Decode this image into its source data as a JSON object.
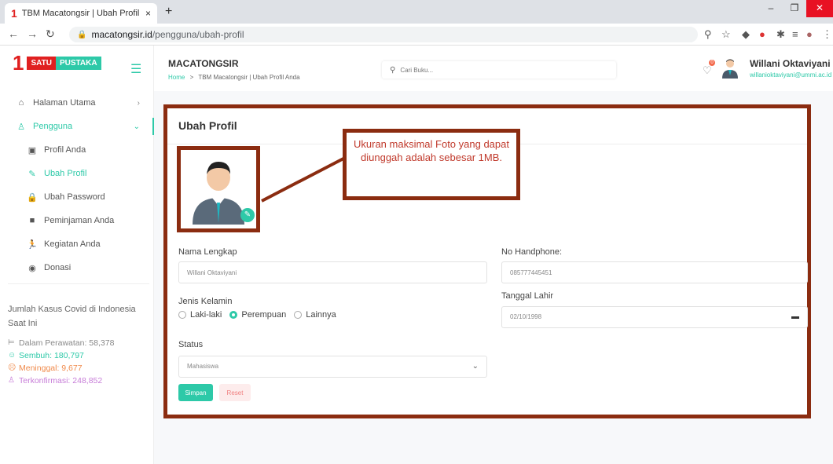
{
  "browser": {
    "tab_title": "TBM Macatongsir | Ubah Profil A",
    "url_host": "macatongsir.id",
    "url_path": "/pengguna/ubah-profil",
    "new_tab": "+",
    "tab_close": "×"
  },
  "brand": {
    "one": "1",
    "satu": "SATU",
    "pustaka": "PUSTAKA"
  },
  "sidebar": {
    "items": [
      {
        "label": "Halaman Utama",
        "icon": "home-icon"
      },
      {
        "label": "Pengguna",
        "icon": "user-icon"
      },
      {
        "label": "Profil Anda",
        "icon": "id-card-icon"
      },
      {
        "label": "Ubah Profil",
        "icon": "edit-icon"
      },
      {
        "label": "Ubah Password",
        "icon": "lock-icon"
      },
      {
        "label": "Peminjaman Anda",
        "icon": "book-icon"
      },
      {
        "label": "Kegiatan Anda",
        "icon": "running-icon"
      },
      {
        "label": "Donasi",
        "icon": "donation-icon"
      }
    ],
    "covid": {
      "heading": "Jumlah Kasus Covid di Indonesia Saat Ini",
      "rawat": "Dalam Perawatan: 58,378",
      "sembuh": "Sembuh: 180,797",
      "meninggal": "Meninggal: 9,677",
      "terkonfirmasi": "Terkonfirmasi: 248,852"
    }
  },
  "header": {
    "site_name": "MACATONGSIR",
    "breadcrumb_home": "Home",
    "breadcrumb_sep": ">",
    "breadcrumb_current": "TBM Macatongsir | Ubah Profil Anda",
    "search_placeholder": "Cari Buku...",
    "notif_count": "0",
    "user_name": "Willani Oktaviyani",
    "user_email": "willanioktaviyani@ummi.ac.id"
  },
  "form": {
    "title": "Ubah Profil",
    "callout": "Ukuran maksimal Foto yang dapat diunggah adalah sebesar 1MB.",
    "nama_label": "Nama Lengkap",
    "nama_value": "Willani Oktaviyani",
    "hp_label": "No Handphone:",
    "hp_value": "085777445451",
    "gender_label": "Jenis Kelamin",
    "gender_options": [
      "Laki-laki",
      "Perempuan",
      "Lainnya"
    ],
    "gender_selected": "Perempuan",
    "dob_label": "Tanggal Lahir",
    "dob_value": "02/10/1998",
    "status_label": "Status",
    "status_value": "Mahasiswa",
    "save_label": "Simpan",
    "reset_label": "Reset"
  },
  "colors": {
    "accent": "#2dc9a8",
    "brand_red": "#e02020",
    "highlight_border": "#8b2c10"
  }
}
